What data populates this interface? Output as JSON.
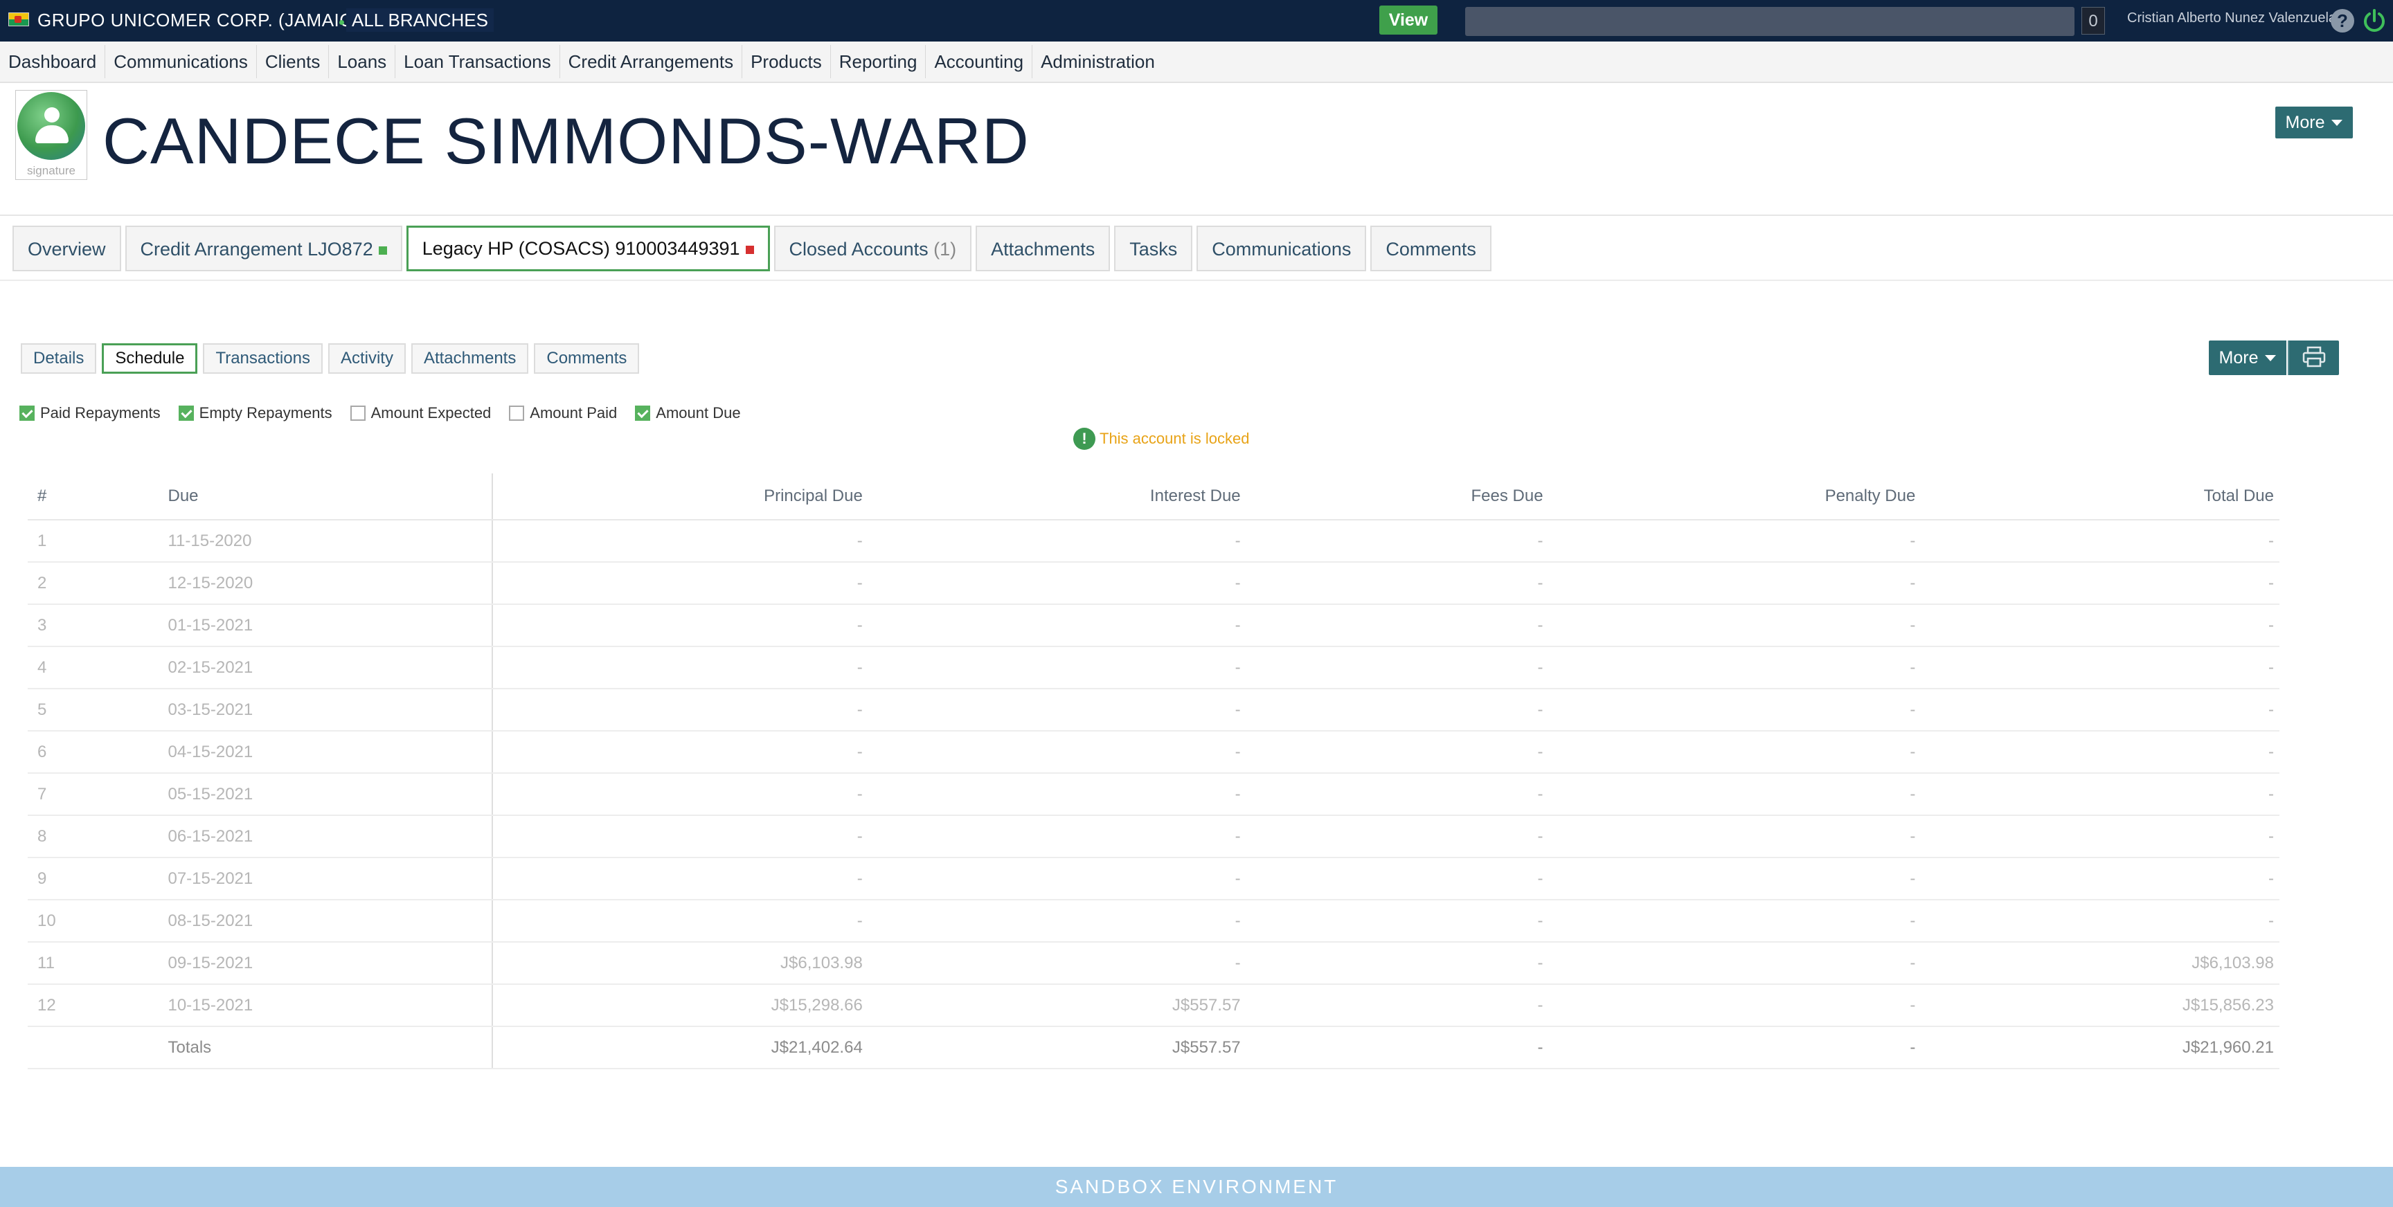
{
  "topbar": {
    "org_name": "GRUPO UNICOMER CORP. (JAMAICA)",
    "branch": "ALL BRANCHES",
    "view_label": "View",
    "search_value": "",
    "notification_count": "0",
    "user_name": "Cristian Alberto Nunez Valenzuela",
    "help_symbol": "?"
  },
  "nav": {
    "items": [
      "Dashboard",
      "Communications",
      "Clients",
      "Loans",
      "Loan Transactions",
      "Credit Arrangements",
      "Products",
      "Reporting",
      "Accounting",
      "Administration"
    ]
  },
  "client": {
    "signature_label": "signature",
    "name": "CANDECE SIMMONDS-WARD",
    "more_label": "More"
  },
  "account_tabs": {
    "overview": "Overview",
    "credit_arrangement": "Credit Arrangement LJO872",
    "legacy_hp": "Legacy HP (COSACS) 910003449391",
    "closed_accounts": "Closed Accounts",
    "closed_count": "(1)",
    "attachments": "Attachments",
    "tasks": "Tasks",
    "communications": "Communications",
    "comments": "Comments"
  },
  "sub_tabs": {
    "details": "Details",
    "schedule": "Schedule",
    "transactions": "Transactions",
    "activity": "Activity",
    "attachments": "Attachments",
    "comments": "Comments",
    "more_label": "More"
  },
  "filters": {
    "paid_repayments": "Paid Repayments",
    "empty_repayments": "Empty Repayments",
    "amount_expected": "Amount Expected",
    "amount_paid": "Amount Paid",
    "amount_due": "Amount Due"
  },
  "lock": {
    "icon_symbol": "!",
    "message": "This account is locked"
  },
  "schedule": {
    "headers": {
      "num": "#",
      "due": "Due",
      "principal": "Principal Due",
      "interest": "Interest Due",
      "fees": "Fees Due",
      "penalty": "Penalty Due",
      "total": "Total Due"
    },
    "rows": [
      {
        "num": "1",
        "due": "11-15-2020",
        "principal": "-",
        "interest": "-",
        "fees": "-",
        "penalty": "-",
        "total": "-"
      },
      {
        "num": "2",
        "due": "12-15-2020",
        "principal": "-",
        "interest": "-",
        "fees": "-",
        "penalty": "-",
        "total": "-"
      },
      {
        "num": "3",
        "due": "01-15-2021",
        "principal": "-",
        "interest": "-",
        "fees": "-",
        "penalty": "-",
        "total": "-"
      },
      {
        "num": "4",
        "due": "02-15-2021",
        "principal": "-",
        "interest": "-",
        "fees": "-",
        "penalty": "-",
        "total": "-"
      },
      {
        "num": "5",
        "due": "03-15-2021",
        "principal": "-",
        "interest": "-",
        "fees": "-",
        "penalty": "-",
        "total": "-"
      },
      {
        "num": "6",
        "due": "04-15-2021",
        "principal": "-",
        "interest": "-",
        "fees": "-",
        "penalty": "-",
        "total": "-"
      },
      {
        "num": "7",
        "due": "05-15-2021",
        "principal": "-",
        "interest": "-",
        "fees": "-",
        "penalty": "-",
        "total": "-"
      },
      {
        "num": "8",
        "due": "06-15-2021",
        "principal": "-",
        "interest": "-",
        "fees": "-",
        "penalty": "-",
        "total": "-"
      },
      {
        "num": "9",
        "due": "07-15-2021",
        "principal": "-",
        "interest": "-",
        "fees": "-",
        "penalty": "-",
        "total": "-"
      },
      {
        "num": "10",
        "due": "08-15-2021",
        "principal": "-",
        "interest": "-",
        "fees": "-",
        "penalty": "-",
        "total": "-"
      },
      {
        "num": "11",
        "due": "09-15-2021",
        "principal": "J$6,103.98",
        "interest": "-",
        "fees": "-",
        "penalty": "-",
        "total": "J$6,103.98"
      },
      {
        "num": "12",
        "due": "10-15-2021",
        "principal": "J$15,298.66",
        "interest": "J$557.57",
        "fees": "-",
        "penalty": "-",
        "total": "J$15,856.23"
      }
    ],
    "totals": {
      "label": "Totals",
      "principal": "J$21,402.64",
      "interest": "J$557.57",
      "fees": "-",
      "penalty": "-",
      "total": "J$21,960.21"
    }
  },
  "footer": {
    "environment": "SANDBOX ENVIRONMENT"
  }
}
